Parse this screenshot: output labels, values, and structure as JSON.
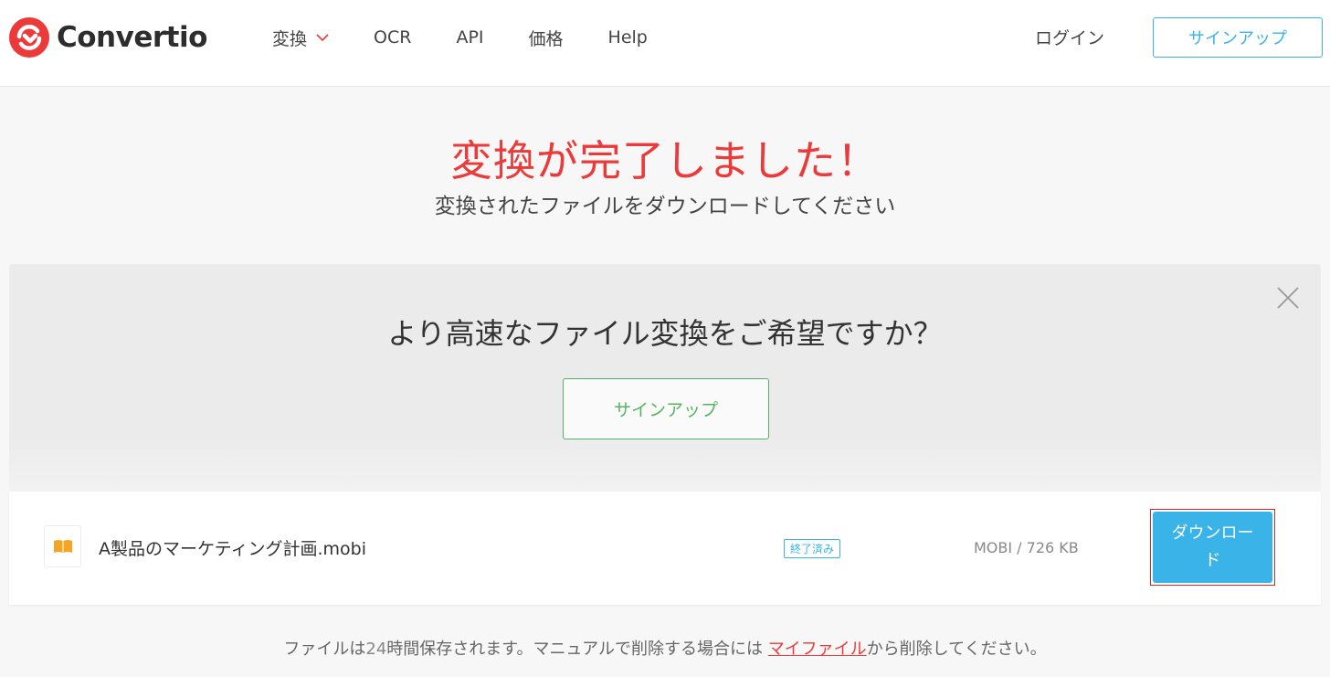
{
  "header": {
    "logo_text": "Convertio",
    "nav": [
      {
        "label": "変換",
        "has_dropdown": true
      },
      {
        "label": "OCR"
      },
      {
        "label": "API"
      },
      {
        "label": "価格"
      },
      {
        "label": "Help"
      }
    ],
    "login_label": "ログイン",
    "signup_label": "サインアップ"
  },
  "hero": {
    "title": "変換が完了しました！",
    "subtitle": "変換されたファイルをダウンロードしてください"
  },
  "promo": {
    "title": "より高速なファイル変換をご希望ですか？",
    "button_label": "サインアップ",
    "close_icon": "close-icon"
  },
  "file": {
    "icon": "book-icon",
    "name": "A製品のマーケティング計画.mobi",
    "status": "終了済み",
    "meta": "MOBI / 726 KB",
    "download_label": "ダウンロード"
  },
  "footer": {
    "text_before": "ファイルは",
    "hours": "24",
    "text_middle": "時間保存されます。マニュアルで削除する場合には ",
    "link_label": "マイファイル",
    "text_after": "から削除してください。"
  },
  "colors": {
    "brand_red": "#ec3a3a",
    "accent_blue": "#3ab3e8",
    "accent_green": "#55b463",
    "file_icon": "#f4a623"
  }
}
